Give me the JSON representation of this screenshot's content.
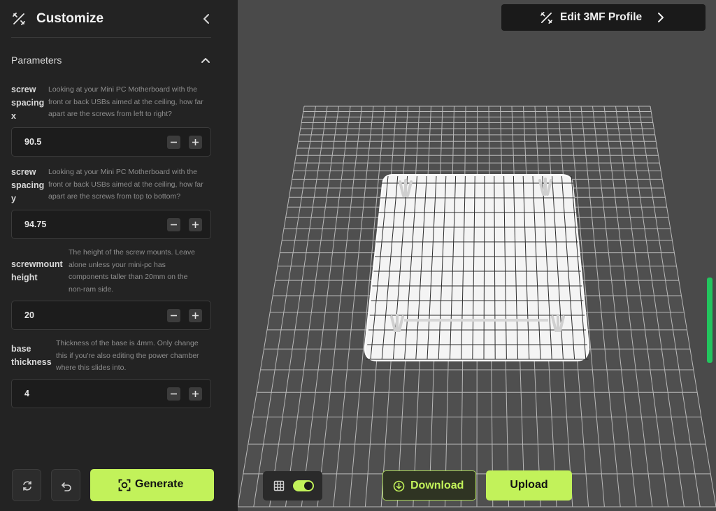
{
  "sidebar": {
    "title": "Customize",
    "section_title": "Parameters",
    "params": [
      {
        "name_lines": [
          "screw",
          "spacing",
          "x"
        ],
        "desc_lines": [
          "Looking at your Mini PC Motherboard with the",
          "front or back USBs aimed at the ceiling, how far",
          "apart are the screws from left to right?"
        ],
        "value": "90.5"
      },
      {
        "name_lines": [
          "screw",
          "spacing",
          "y"
        ],
        "desc_lines": [
          "Looking at your Mini PC Motherboard with the",
          "front or back USBs aimed at the ceiling, how far",
          "apart are the screws from top to bottom?"
        ],
        "value": "94.75"
      },
      {
        "name_lines": [
          "screwmount",
          "height"
        ],
        "desc_lines": [
          "The height of the screw mounts. Leave",
          "alone unless your mini-pc has",
          "components taller than 20mm on the",
          "non-ram side."
        ],
        "value": "20"
      },
      {
        "name_lines": [
          "base",
          "thickness"
        ],
        "desc_lines": [
          "Thickness of the base is 4mm. Only change",
          "this if you're also editing the power chamber",
          "where this slides into."
        ],
        "value": "4"
      }
    ],
    "generate_label": "Generate"
  },
  "viewport": {
    "edit_profile_label": "Edit 3MF Profile",
    "download_label": "Download",
    "upload_label": "Upload",
    "view_toggle_on": true
  },
  "colors": {
    "accent": "#c2f25a",
    "sidebar_bg": "#232323",
    "viewport_bg": "#4a4a4a",
    "scroll_indicator": "#22c55e"
  }
}
